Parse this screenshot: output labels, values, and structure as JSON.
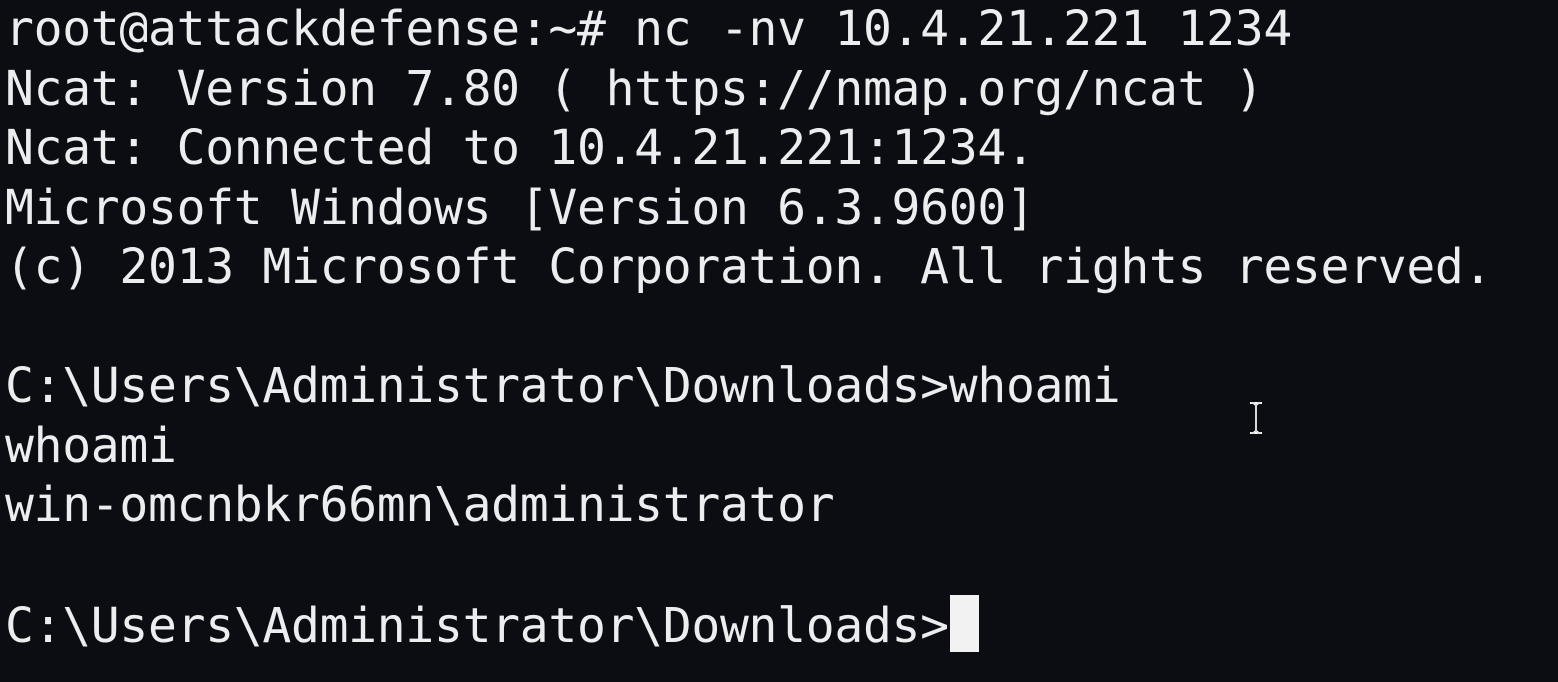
{
  "terminal": {
    "lines": [
      "root@attackdefense:~# nc -nv 10.4.21.221 1234",
      "Ncat: Version 7.80 ( https://nmap.org/ncat )",
      "Ncat: Connected to 10.4.21.221:1234.",
      "Microsoft Windows [Version 6.3.9600]",
      "(c) 2013 Microsoft Corporation. All rights reserved.",
      "",
      "C:\\Users\\Administrator\\Downloads>whoami",
      "whoami",
      "win-omcnbkr66mn\\administrator",
      ""
    ],
    "prompt": "C:\\Users\\Administrator\\Downloads>",
    "colors": {
      "background": "#0b0d12",
      "foreground": "#ecedee",
      "cursor": "#f2f2f2"
    },
    "mouse_pointer_icon": "text-ibeam-icon"
  }
}
